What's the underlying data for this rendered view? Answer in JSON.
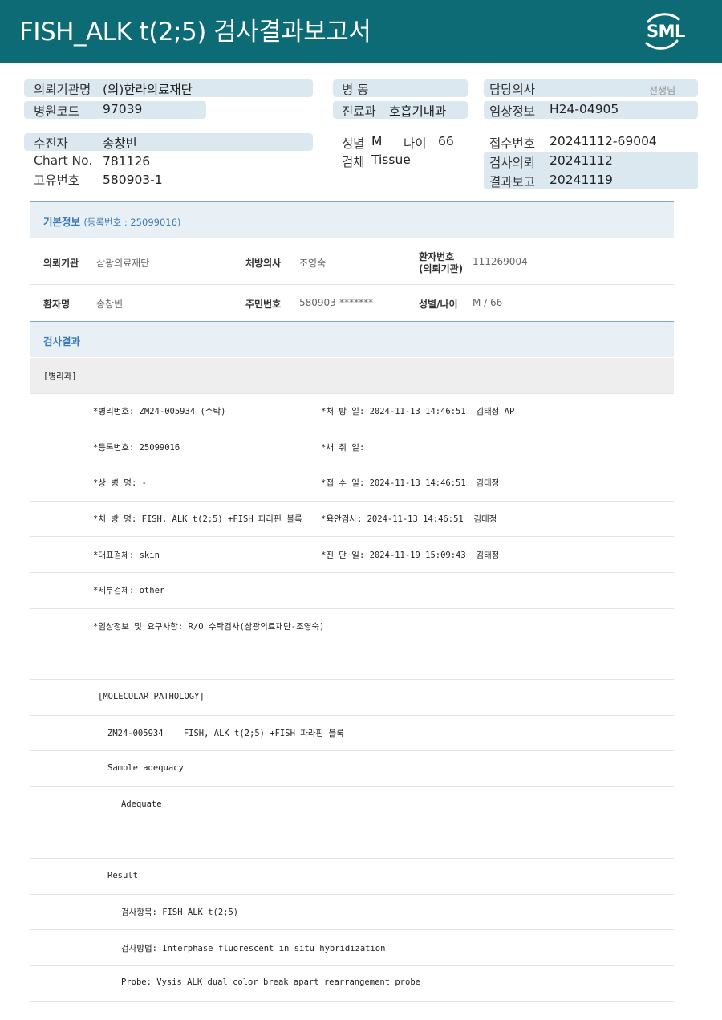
{
  "header": {
    "title": "FISH_ALK  t(2;5) 검사결과보고서",
    "logo_text": "SML"
  },
  "info": {
    "institution_label": "의뢰기관명",
    "institution_value": "(의)한라의료재단",
    "hospital_code_label": "병원코드",
    "hospital_code_value": "97039",
    "ward_label": "병 동",
    "ward_value": "",
    "department_label": "진료과",
    "department_value": "호흡기내과",
    "doctor_label": "담당의사",
    "doctor_value": "",
    "doctor_suffix": "선생님",
    "clinical_label": "임상정보",
    "clinical_value": "H24-04905",
    "patient_label": "수진자",
    "patient_value": "송창빈",
    "chart_label": "Chart No.",
    "chart_value": "781126",
    "unique_label": "고유번호",
    "unique_value": "580903-1",
    "sex_label": "성별",
    "sex_value": "M",
    "age_label": "나이",
    "age_value": "66",
    "specimen_label": "검체",
    "specimen_value": "Tissue",
    "receipt_label": "접수번호",
    "receipt_value": "20241112-69004",
    "request_label": "검사의뢰",
    "request_value": "20241112",
    "report_label": "결과보고",
    "report_value": "20241119"
  },
  "basic": {
    "title": "기본정보",
    "reg": "(등록번호 : 25099016)",
    "inst_k": "의뢰기관",
    "inst_v": "삼광의료재단",
    "presc_k": "처방의사",
    "presc_v": "조영숙",
    "pno_k1": "환자번호",
    "pno_k2": "(의뢰기관)",
    "pno_v": "111269004",
    "name_k": "환자명",
    "name_v": "송창빈",
    "rrn_k": "주민번호",
    "rrn_v": "580903-*******",
    "sexage_k": "성별/나이",
    "sexage_v": "M / 66"
  },
  "results": {
    "title": "검사결과",
    "dept": "[병리과]",
    "lines": [
      "*병리번호: ZM24-005934 (수탁)",
      "*등록번호: 25099016",
      "*상 병 명: -",
      "*처 방 명: FISH, ALK t(2;5) +FISH 파라핀 블록",
      "*대표검체: skin",
      "*세부검체: other",
      "*임상정보 및 요구사항: R/O 수탁검사(삼광의료재단-조영숙)"
    ],
    "right_lines": [
      "*처 방 일: 2024-11-13 14:46:51  김태정 AP",
      "*채 취 일:",
      "*접 수 일: 2024-11-13 14:46:51  김태정",
      "*육안검사: 2024-11-13 14:46:51  김태정",
      "*진 단 일: 2024-11-19 15:09:43  김태정"
    ],
    "mol_header": "[MOLECULAR PATHOLOGY]",
    "mol_lines": [
      "ZM24-005934    FISH, ALK t(2;5) +FISH 파라핀 블록",
      "Sample adequacy",
      "Adequate",
      "",
      "Result",
      "검사항목: FISH ALK t(2;5)",
      "검사방법: Interphase fluorescent in situ hybridization",
      "Probe: Vysis ALK dual color break apart rearrangement probe"
    ]
  }
}
